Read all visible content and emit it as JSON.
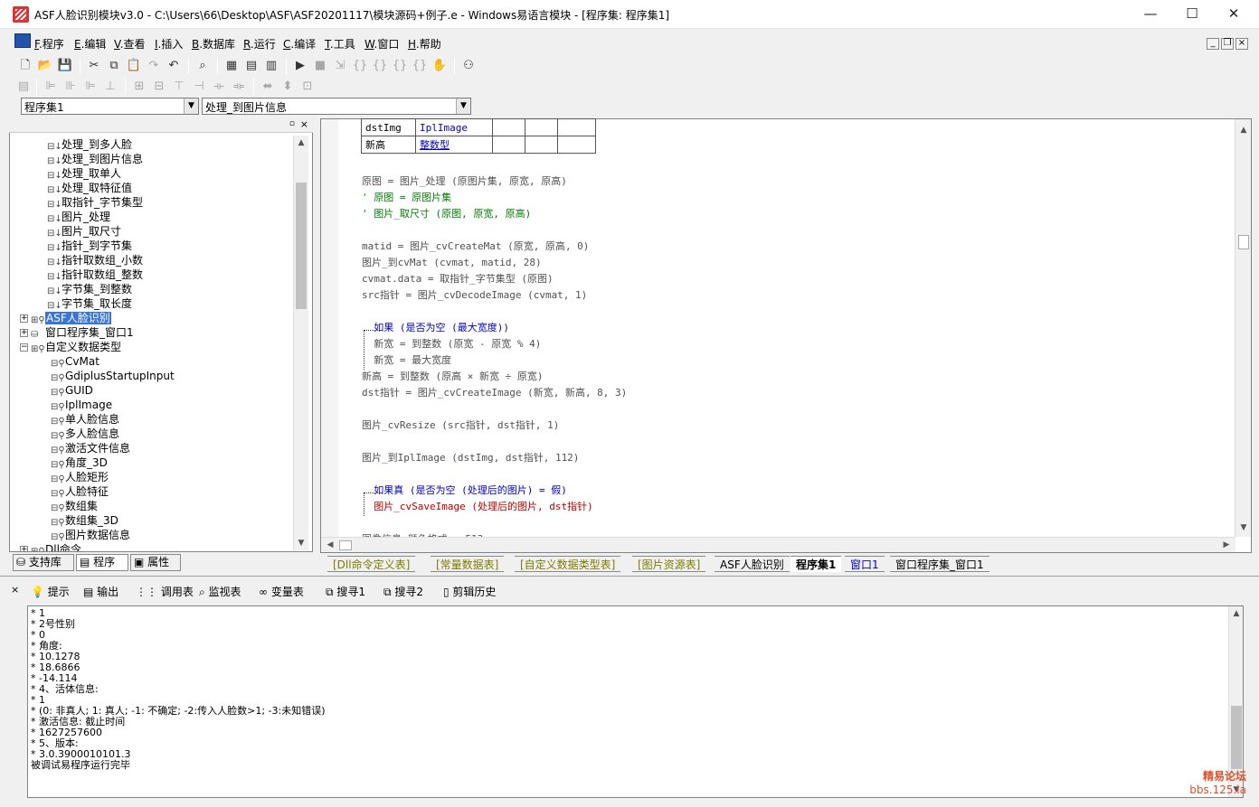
{
  "window": {
    "title": "ASF人脸识别模块v3.0 - C:\\Users\\66\\Desktop\\ASF\\ASF20201117\\模块源码+例子.e - Windows易语言模块 - [程序集: 程序集1]",
    "minimize": "—",
    "maximize": "☐",
    "close": "✕"
  },
  "menu": [
    {
      "key": "F",
      "label": ".程序"
    },
    {
      "key": "E",
      "label": ".编辑"
    },
    {
      "key": "V",
      "label": ".查看"
    },
    {
      "key": "I",
      "label": ".插入"
    },
    {
      "key": "B",
      "label": ".数据库"
    },
    {
      "key": "R",
      "label": ".运行"
    },
    {
      "key": "C",
      "label": ".编译"
    },
    {
      "key": "T",
      "label": ".工具"
    },
    {
      "key": "W",
      "label": ".窗口"
    },
    {
      "key": "H",
      "label": ".帮助"
    }
  ],
  "selectors": {
    "assembly": "程序集1",
    "subroutine": "处理_到图片信息"
  },
  "tree": {
    "subs": [
      "处理_到多人脸",
      "处理_到图片信息",
      "处理_取单人",
      "处理_取特征值",
      "取指针_字节集型",
      "图片_处理",
      "图片_取尺寸",
      "指针_到字节集",
      "指针取数组_小数",
      "指针取数组_整数",
      "字节集_到整数",
      "字节集_取长度"
    ],
    "modules": [
      "ASF人脸识别",
      "窗口程序集_窗口1",
      "自定义数据类型"
    ],
    "types": [
      "CvMat",
      "GdiplusStartupInput",
      "GUID",
      "IplImage",
      "单人脸信息",
      "多人脸信息",
      "激活文件信息",
      "角度_3D",
      "人脸矩形",
      "人脸特征",
      "数组集",
      "数组集_3D",
      "图片数据信息"
    ],
    "last": "Dll命令"
  },
  "left_tabs": [
    "支持库",
    "程序",
    "属性"
  ],
  "code": {
    "table_rows": [
      [
        "dstImg",
        "IplImage"
      ],
      [
        "新高",
        "整数型"
      ]
    ],
    "lines": [
      {
        "t": "原图 = 图片_处理 (原图片集, 原宽, 原高)",
        "c": "k-gray"
      },
      {
        "t": "' 原图 = 原图片集",
        "c": "k-green"
      },
      {
        "t": "' 图片_取尺寸 (原图, 原宽, 原高)",
        "c": "k-green"
      },
      {
        "t": "",
        "c": ""
      },
      {
        "t": "matid = 图片_cvCreateMat (原宽, 原高, 0)",
        "c": "k-gray"
      },
      {
        "t": "图片_到cvMat (cvmat, matid, 28)",
        "c": "k-gray"
      },
      {
        "t": "cvmat.data = 取指针_字节集型 (原图)",
        "c": "k-gray"
      },
      {
        "t": "src指针 = 图片_cvDecodeImage (cvmat, 1)",
        "c": "k-gray"
      },
      {
        "t": "",
        "c": ""
      },
      {
        "t": "  如果 (是否为空 (最大宽度))",
        "c": "k-blue"
      },
      {
        "t": "  新宽 = 到整数 (原宽 - 原宽 % 4)",
        "c": "k-gray"
      },
      {
        "t": "  新宽 = 最大宽度",
        "c": "k-gray"
      },
      {
        "t": "新高 = 到整数 (原高 × 新宽 ÷ 原宽)",
        "c": "k-gray"
      },
      {
        "t": "dst指针 = 图片_cvCreateImage (新宽, 新高, 8, 3)",
        "c": "k-gray"
      },
      {
        "t": "",
        "c": ""
      },
      {
        "t": "图片_cvResize (src指针, dst指针, 1)",
        "c": "k-gray"
      },
      {
        "t": "",
        "c": ""
      },
      {
        "t": "图片_到IplImage (dstImg, dst指针, 112)",
        "c": "k-gray"
      },
      {
        "t": "",
        "c": ""
      },
      {
        "t": "  如果真 (是否为空 (处理后的图片) = 假)",
        "c": "k-blue"
      },
      {
        "t": "  图片_cvSaveImage (处理后的图片, dst指针)",
        "c": "k-red"
      },
      {
        "t": "",
        "c": ""
      },
      {
        "t": "图像信息.颜色格式 = 513",
        "c": "k-gray"
      }
    ]
  },
  "editor_tabs": [
    "[Dll命令定义表]",
    "[常量数据表]",
    "[自定义数据类型表]",
    "[图片资源表]",
    "ASF人脸识别",
    "程序集1",
    "窗口1",
    "窗口程序集_窗口1"
  ],
  "output_tabs": [
    "提示",
    "输出",
    "调用表",
    "监视表",
    "变量表",
    "搜寻1",
    "搜寻2",
    "剪辑历史"
  ],
  "output_lines": [
    "* 1",
    "* 2号性别",
    "* 0",
    "* 角度:",
    "* 10.1278",
    "* 18.6866",
    "* -14.114",
    "* 4、活体信息:",
    "* 1",
    "* (0: 非真人; 1: 真人; -1: 不确定; -2:传入人脸数>1; -3:未知错误)",
    "* 激活信息: 截止时间",
    "* 1627257600",
    "* 5、版本:",
    "* 3.0.3900010101.3",
    "被调试易程序运行完毕"
  ],
  "watermark": {
    "line1": "精易论坛",
    "line2": "bbs.125.la"
  },
  "colors": {
    "accent": "#3875d7",
    "code_blue": "#0000c8",
    "code_red": "#c00000",
    "comment_green": "#008000"
  }
}
